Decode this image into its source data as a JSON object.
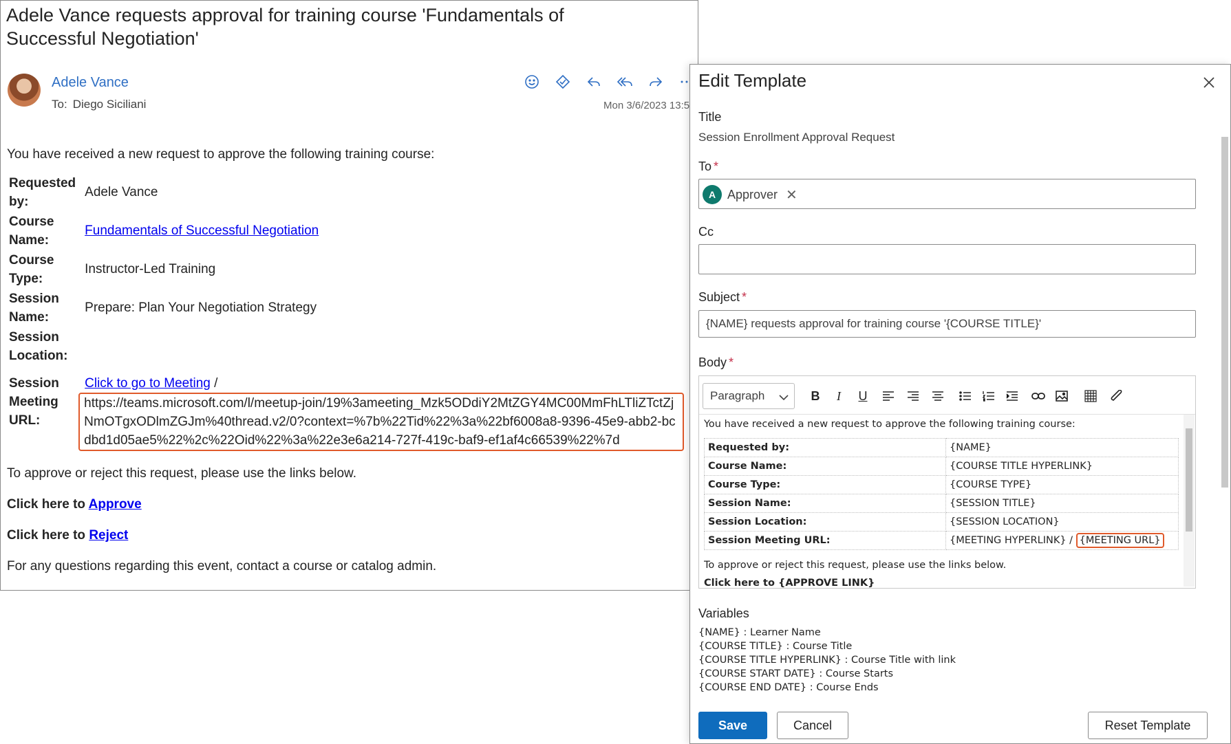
{
  "email": {
    "subject": "Adele Vance requests approval for training course 'Fundamentals of Successful Negotiation'",
    "sender": "Adele Vance",
    "to_label": "To:",
    "to_name": "Diego Siciliani",
    "date": "Mon 3/6/2023 13:5",
    "intro": "You have received a new request to approve the following training course:",
    "rows": [
      {
        "label": "Requested by:",
        "value": "Adele Vance"
      },
      {
        "label": "Course Name:",
        "value": "Fundamentals of Successful Negotiation"
      },
      {
        "label": "Course Type:",
        "value": "Instructor-Led Training"
      },
      {
        "label": "Session Name:",
        "value": "Prepare: Plan Your Negotiation Strategy"
      },
      {
        "label": "Session Location:",
        "value": ""
      },
      {
        "label": "Session Meeting URL:",
        "value": ""
      }
    ],
    "meeting_link_text": "Click to go to Meeting",
    "meeting_sep": " / ",
    "meeting_url": "https://teams.microsoft.com/l/meetup-join/19%3ameeting_Mzk5ODdiY2MtZGY4MC00MmFhLTliZTctZjNmOTgxODlmZGJm%40thread.v2/0?context=%7b%22Tid%22%3a%22bf6008a8-9396-45e9-abb2-bcdbd1d05ae5%22%2c%22Oid%22%3a%22e3e6a214-727f-419c-baf9-ef1af4c66539%22%7d",
    "instructions": "To approve or reject this request, please use the links below.",
    "approve_prefix": "Click here to ",
    "approve_link": "Approve",
    "reject_prefix": "Click here to ",
    "reject_link": "Reject",
    "footer": "For any questions regarding this event, contact a course or catalog admin."
  },
  "panel": {
    "title": "Edit Template",
    "title_label": "Title",
    "title_value": "Session Enrollment Approval Request",
    "to_label": "To",
    "to_chip": {
      "initial": "A",
      "name": "Approver"
    },
    "cc_label": "Cc",
    "subject_label": "Subject",
    "subject_value": "{NAME} requests approval for training course '{COURSE TITLE}'",
    "body_label": "Body",
    "paragraph_select": "Paragraph",
    "editor": {
      "intro": "You have received a new request to approve the following training course:",
      "rows": [
        {
          "k": "Requested by:",
          "v": "{NAME}"
        },
        {
          "k": "Course Name:",
          "v": "{COURSE TITLE HYPERLINK}"
        },
        {
          "k": "Course Type:",
          "v": "{COURSE TYPE}"
        },
        {
          "k": "Session Name:",
          "v": "{SESSION TITLE}"
        },
        {
          "k": "Session Location:",
          "v": "{SESSION LOCATION}"
        }
      ],
      "meeting_row": {
        "k": "Session Meeting URL:",
        "v1": "{MEETING HYPERLINK} / ",
        "v2": "{MEETING URL}"
      },
      "instructions": "To approve or reject this request, please use the links below.",
      "clipped_line": "Click here to {APPROVE LINK}"
    },
    "variables_label": "Variables",
    "variables": [
      "{NAME} : Learner Name",
      "{COURSE TITLE} : Course Title",
      "{COURSE TITLE HYPERLINK} : Course Title with link",
      "{COURSE START DATE} : Course Starts",
      "{COURSE END DATE} : Course Ends"
    ],
    "buttons": {
      "save": "Save",
      "cancel": "Cancel",
      "reset": "Reset Template"
    }
  },
  "colors": {
    "accent": "#0f6cbd",
    "highlight": "#e05a2b",
    "link": "#0000ee",
    "sender": "#2f6fc4",
    "avatar_chip": "#0e7a6d"
  }
}
